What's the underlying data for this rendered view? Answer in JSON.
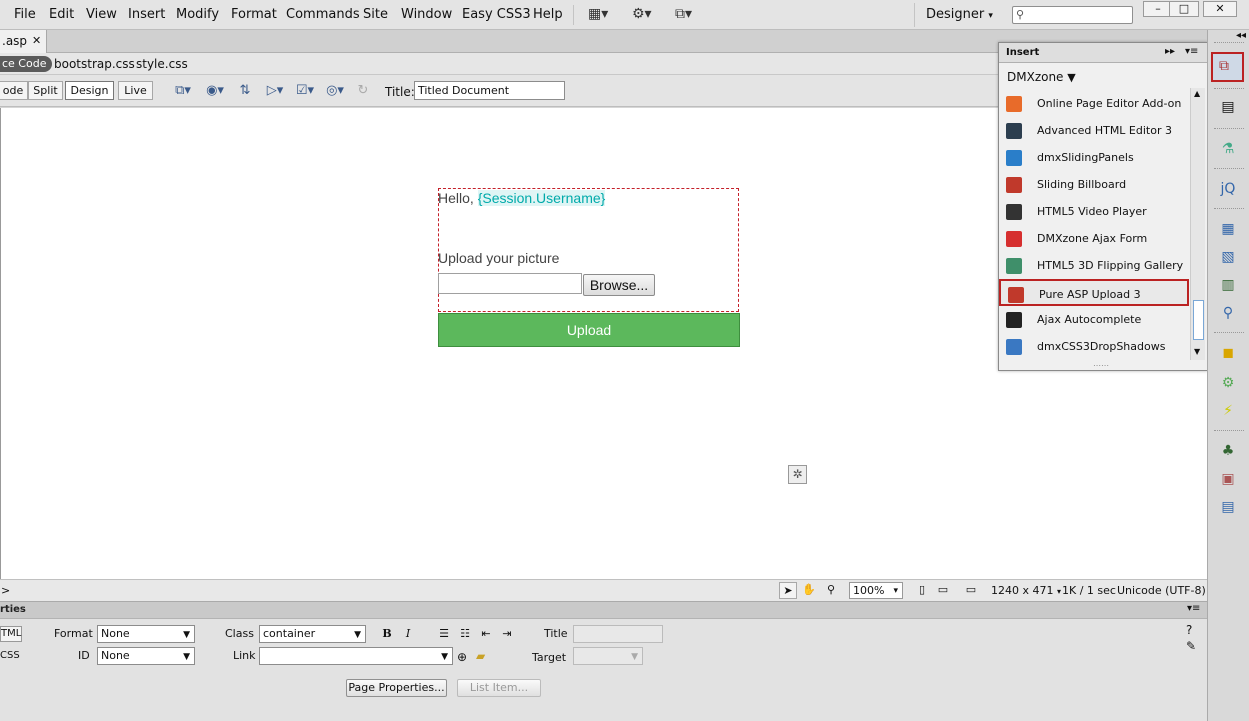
{
  "menu": {
    "items": [
      "File",
      "Edit",
      "View",
      "Insert",
      "Modify",
      "Format",
      "Commands",
      "Site",
      "Window",
      "Easy CSS3",
      "Help"
    ],
    "workspace": "Designer",
    "window_buttons": [
      "–",
      "□",
      "✕"
    ]
  },
  "doc": {
    "tab_name": ".asp",
    "tab_close": "✕",
    "related": {
      "source": "ce Code",
      "files": [
        "bootstrap.css",
        "style.css"
      ]
    },
    "views": [
      "ode",
      "Split",
      "Design",
      "Live"
    ],
    "title_label": "Title:",
    "title_value": "Titled Document"
  },
  "canvas": {
    "hello_prefix": "Hello, ",
    "session_var": "{Session.Username}",
    "upload_label": "Upload your picture",
    "browse_label": "Browse...",
    "upload_button": "Upload"
  },
  "status": {
    "zoom": "100%",
    "dimensions": "1240 x 471",
    "size_time": "1K / 1 sec",
    "encoding": "Unicode (UTF-8)",
    "left_marker": ">"
  },
  "properties": {
    "title": "rties",
    "tabs": [
      "TML",
      "CSS"
    ],
    "format_label": "Format",
    "format_value": "None",
    "id_label": "ID",
    "id_value": "None",
    "class_label": "Class",
    "class_value": "container",
    "link_label": "Link",
    "link_value": "",
    "title_label": "Title",
    "target_label": "Target",
    "bold": "B",
    "italic": "I",
    "page_properties": "Page Properties...",
    "list_item": "List Item..."
  },
  "insert_panel": {
    "title": "Insert",
    "category": "DMXzone",
    "items": [
      {
        "label": "Online Page Editor Add-on",
        "icon": "online-page-editor-icon",
        "color": "#e86b2a"
      },
      {
        "label": "Advanced HTML Editor 3",
        "icon": "html-editor-icon",
        "color": "#2c3e4f"
      },
      {
        "label": "dmxSlidingPanels",
        "icon": "sliding-panels-icon",
        "color": "#2a7ec9"
      },
      {
        "label": "Sliding Billboard",
        "icon": "sliding-billboard-icon",
        "color": "#c0392b"
      },
      {
        "label": "HTML5 Video Player",
        "icon": "video-player-icon",
        "color": "#333333"
      },
      {
        "label": "DMXzone Ajax Form",
        "icon": "ajax-form-icon",
        "color": "#d62f2f"
      },
      {
        "label": "HTML5 3D Flipping Gallery",
        "icon": "flipping-gallery-icon",
        "color": "#3f8f6a"
      },
      {
        "label": "Pure ASP Upload 3",
        "icon": "upload-icon",
        "color": "#c0392b"
      },
      {
        "label": "Ajax Autocomplete",
        "icon": "magnifier-icon",
        "color": "#222222"
      },
      {
        "label": "dmxCSS3DropShadows",
        "icon": "drop-shadows-icon",
        "color": "#3a78c2"
      }
    ],
    "selected_index": 7
  }
}
